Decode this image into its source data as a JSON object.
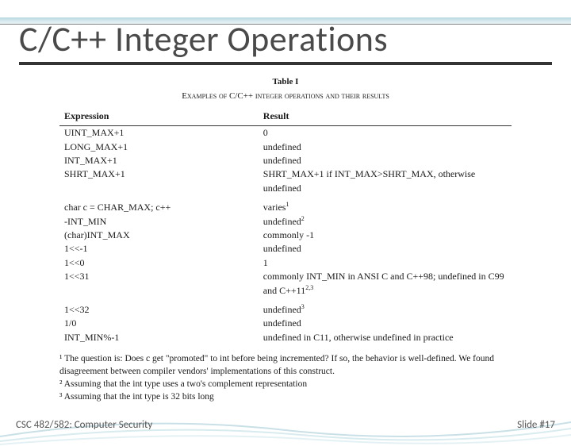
{
  "title": "C/C++ Integer Operations",
  "table": {
    "caption": "Table I",
    "subcaption": "Examples of C/C++ integer operations and their results",
    "headers": {
      "expr": "Expression",
      "result": "Result"
    },
    "rows": [
      {
        "expr": "UINT_MAX+1",
        "result": "0"
      },
      {
        "expr": "LONG_MAX+1",
        "result": "undefined"
      },
      {
        "expr": "INT_MAX+1",
        "result": "undefined"
      },
      {
        "expr": "SHRT_MAX+1",
        "result": "SHRT_MAX+1 if INT_MAX>SHRT_MAX, otherwise undefined",
        "mono_result_prefix": true
      },
      {
        "spacer": true
      },
      {
        "expr": "char c = CHAR_MAX; c++",
        "result": "varies",
        "sup": "1"
      },
      {
        "expr": "-INT_MIN",
        "result": "undefined",
        "sup": "2"
      },
      {
        "expr": "(char)INT_MAX",
        "result": "commonly -1"
      },
      {
        "expr": "1<<-1",
        "result": "undefined"
      },
      {
        "expr": "1<<0",
        "result": "1"
      },
      {
        "expr": "1<<31",
        "result": "commonly INT_MIN in ANSI C and C++98; undefined in C99 and C++11",
        "sup": "2,3"
      },
      {
        "spacer": true
      },
      {
        "expr": "1<<32",
        "result": "undefined",
        "sup": "3"
      },
      {
        "expr": "1/0",
        "result": "undefined"
      },
      {
        "expr": "INT_MIN%-1",
        "result": "undefined in C11, otherwise undefined in practice"
      }
    ]
  },
  "footnotes": {
    "f1": "¹ The question is: Does c get \"promoted\" to int before being incremented? If so, the behavior is well-defined. We found disagreement between compiler vendors' implementations of this construct.",
    "f2": "² Assuming that the int type uses a two's complement representation",
    "f3": "³ Assuming that the int type is 32 bits long"
  },
  "footer": {
    "left": "CSC 482/582: Computer Security",
    "right": "Slide #17"
  }
}
